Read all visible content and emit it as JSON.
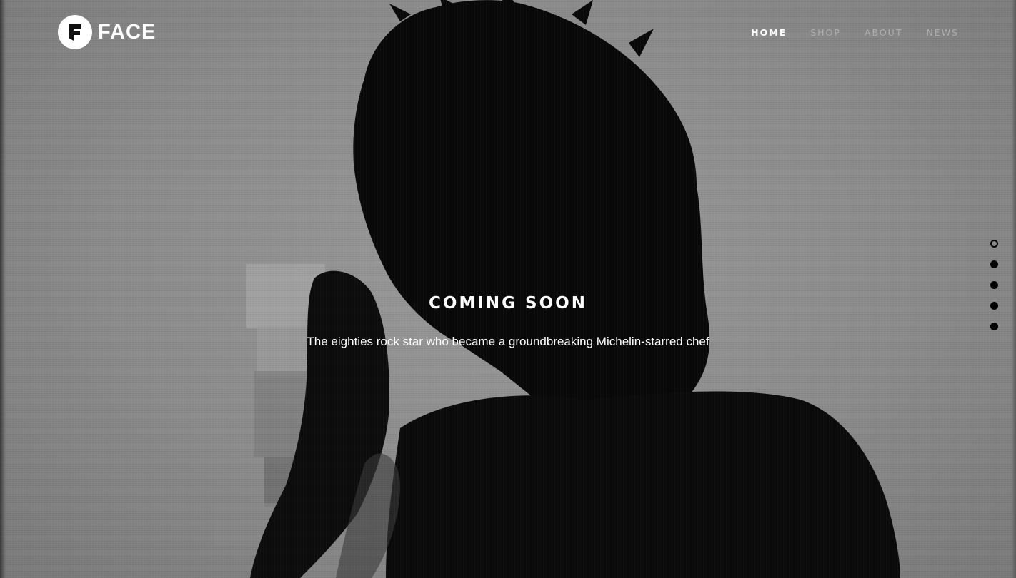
{
  "brand": {
    "name": "FACE",
    "logo_letter": "F"
  },
  "nav": [
    {
      "label": "HOME",
      "active": true
    },
    {
      "label": "SHOP",
      "active": false
    },
    {
      "label": "ABOUT",
      "active": false
    },
    {
      "label": "NEWS",
      "active": false
    }
  ],
  "hero": {
    "title": "COMING SOON",
    "subtitle": "The eighties rock star who became a groundbreaking Michelin-starred chef"
  },
  "slider": {
    "count": 5,
    "active_index": 0
  },
  "colors": {
    "background": "#8c8c8c",
    "silhouette": "#0a0a0a",
    "text": "#ffffff",
    "nav_inactive": "#bebebe"
  }
}
